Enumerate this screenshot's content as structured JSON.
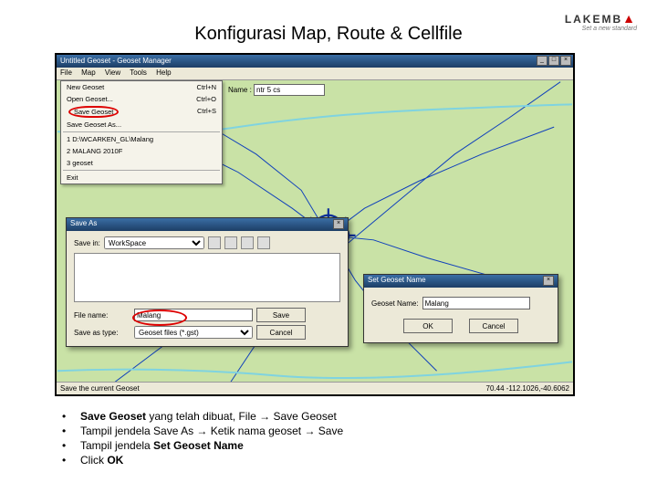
{
  "logo": {
    "brand": "LAKEMB",
    "tri": "▲",
    "tagline": "Set a new standard"
  },
  "title": "Konfigurasi Map, Route & Cellfile",
  "mainwin": {
    "title": "Untitled Geoset - Geoset Manager",
    "menus": [
      "File",
      "Map",
      "View",
      "Tools",
      "Help"
    ],
    "label_name": "Name :",
    "name_value": "ntr 5 cs",
    "status_left": "Save the current Geoset",
    "status_right": "70.44    -112.1026,-40.6062"
  },
  "filemenu": {
    "items": [
      {
        "label": "New Geoset",
        "accel": "Ctrl+N"
      },
      {
        "label": "Open Geoset...",
        "accel": "Ctrl+O"
      },
      {
        "label": "Save Geoset",
        "accel": "Ctrl+S",
        "highlight": true
      },
      {
        "label": "Save Geoset As...",
        "accel": ""
      }
    ],
    "recent": [
      "1 D:\\WCARKEN_GL\\Malang",
      "2 MALANG 2010F",
      "3 geoset"
    ],
    "exit": "Exit"
  },
  "saveas": {
    "title": "Save As",
    "savein_label": "Save in:",
    "savein_value": "WorkSpace",
    "filename_label": "File name:",
    "filename_value": "Malang",
    "type_label": "Save as type:",
    "type_value": "Geoset files (*.gst)",
    "save_btn": "Save",
    "cancel_btn": "Cancel"
  },
  "setname": {
    "title": "Set Geoset Name",
    "label": "Geoset Name:",
    "value": "Malang",
    "ok": "OK",
    "cancel": "Cancel"
  },
  "notes": [
    {
      "pre": "",
      "b1": "Save Geoset",
      "mid": " yang telah dibuat, File → Save Geoset"
    },
    {
      "pre": "Tampil jendela Save As → Ketik nama geoset → Save",
      "b1": "",
      "mid": ""
    },
    {
      "pre": "Tampil jendela ",
      "b1": "Set Geoset Name",
      "mid": ""
    },
    {
      "pre": "Click ",
      "b1": "OK",
      "mid": ""
    }
  ]
}
